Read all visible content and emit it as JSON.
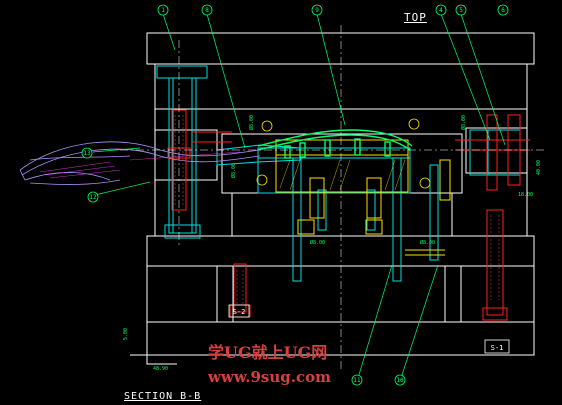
{
  "drawing": {
    "view_title_top": "TOP",
    "view_title_section": "SECTION B-B",
    "watermark_line1": "学UG就上UG网",
    "watermark_line2": "www.9sug.com",
    "colors": {
      "background": "#000000",
      "outline": "#ffffff",
      "cyan": "#00e0e0",
      "red": "#ff2020",
      "green": "#00ff66",
      "yellow": "#ffe000",
      "magenta": "#ff40ff",
      "watermark": "#d84040"
    }
  },
  "balloons": [
    {
      "id": "b1",
      "label": "1"
    },
    {
      "id": "b8",
      "label": "8"
    },
    {
      "id": "b9",
      "label": "9"
    },
    {
      "id": "b4",
      "label": "4"
    },
    {
      "id": "b5",
      "label": "5"
    },
    {
      "id": "b6",
      "label": "6"
    },
    {
      "id": "b13",
      "label": "13"
    },
    {
      "id": "b12",
      "label": "12"
    },
    {
      "id": "b11",
      "label": "11"
    },
    {
      "id": "b10",
      "label": "10"
    }
  ],
  "callouts": {
    "s2": "S-2",
    "s1": "S-1"
  },
  "dimensions": [
    {
      "id": "d1",
      "text": "Ø8.00"
    },
    {
      "id": "d2",
      "text": "Ø8.00"
    },
    {
      "id": "d3",
      "text": "Ø8.00"
    },
    {
      "id": "d4",
      "text": "40.00"
    },
    {
      "id": "d5",
      "text": "5.00"
    },
    {
      "id": "d6",
      "text": "18.00"
    },
    {
      "id": "d7",
      "text": "Ø8.00"
    },
    {
      "id": "d8",
      "text": "48.90"
    },
    {
      "id": "d9",
      "text": "Ø8.00"
    }
  ]
}
